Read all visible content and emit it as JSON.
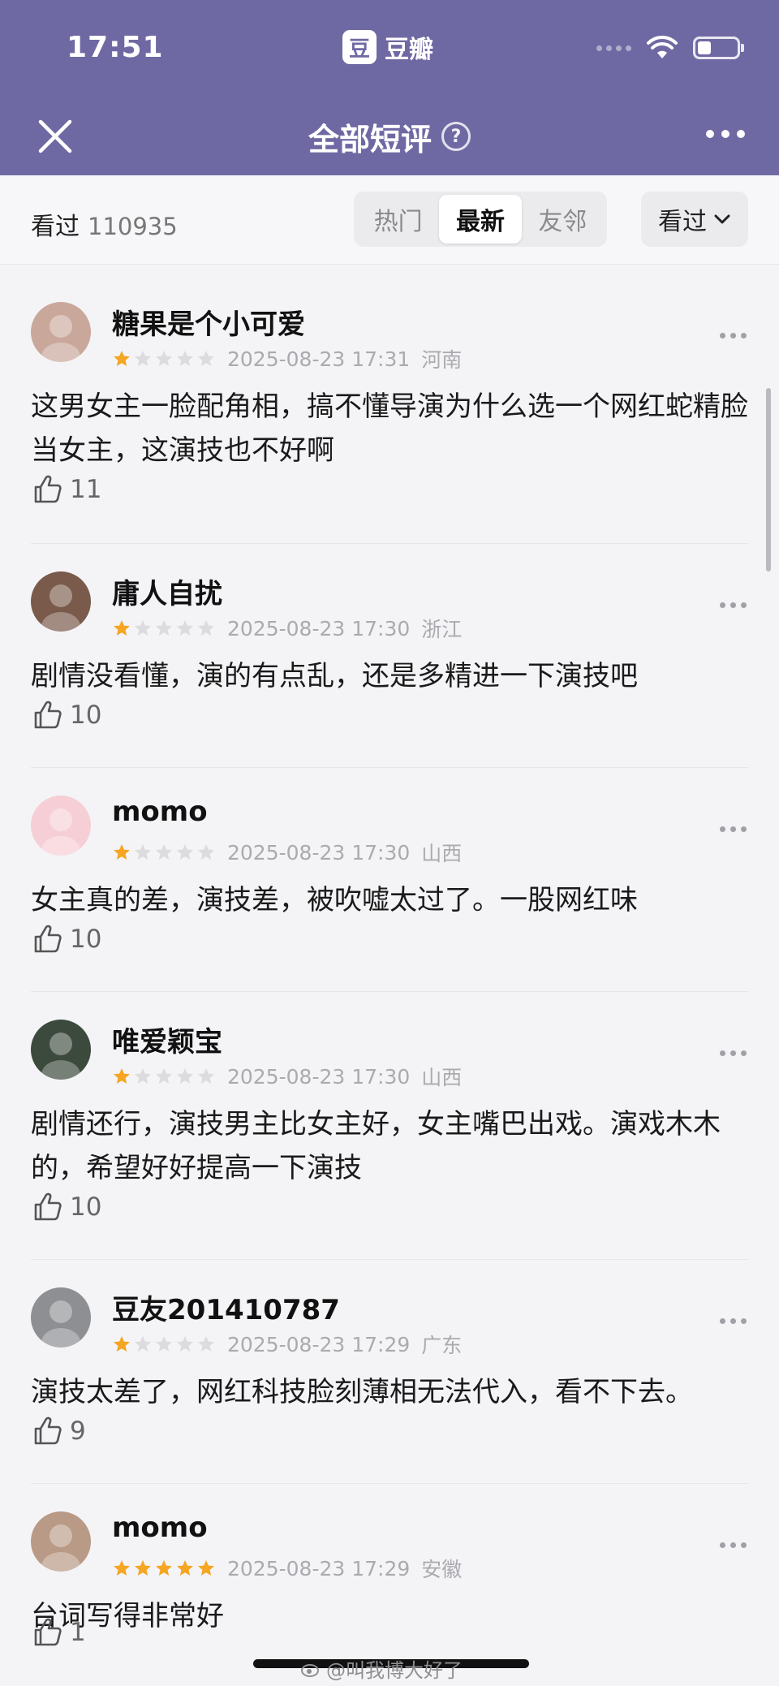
{
  "status_bar": {
    "time": "17:51",
    "app_logo_char": "豆",
    "app_name": "豆瓣",
    "battery_level": 0.35
  },
  "nav": {
    "title": "全部短评",
    "help_symbol": "?"
  },
  "filter": {
    "seen_label": "看过",
    "seen_count": "110935",
    "tabs": [
      {
        "label": "热门",
        "active": false
      },
      {
        "label": "最新",
        "active": true
      },
      {
        "label": "友邻",
        "active": false
      }
    ],
    "dropdown_label": "看过"
  },
  "comments": [
    {
      "user": "糖果是个小可爱",
      "rating": 1,
      "date": "2025-08-23 17:31",
      "location": "河南",
      "content": "这男女主一脸配角相，搞不懂导演为什么选一个网红蛇精脸当女主，这演技也不好啊",
      "likes": "11",
      "avatar_color": "#c9a89b"
    },
    {
      "user": "庸人自扰",
      "rating": 1,
      "date": "2025-08-23 17:30",
      "location": "浙江",
      "content": "剧情没看懂，演的有点乱，还是多精进一下演技吧",
      "likes": "10",
      "avatar_color": "#7a5a4a"
    },
    {
      "user": "momo",
      "rating": 1,
      "date": "2025-08-23 17:30",
      "location": "山西",
      "content": "女主真的差，演技差，被吹嘘太过了。一股网红味",
      "likes": "10",
      "avatar_color": "#f6cfd6"
    },
    {
      "user": "唯爱颖宝",
      "rating": 1,
      "date": "2025-08-23 17:30",
      "location": "山西",
      "content": "剧情还行，演技男主比女主好，女主嘴巴出戏。演戏木木的，希望好好提高一下演技",
      "likes": "10",
      "avatar_color": "#3b4a3c"
    },
    {
      "user": "豆友201410787",
      "rating": 1,
      "date": "2025-08-23 17:29",
      "location": "广东",
      "content": "演技太差了，网红科技脸刻薄相无法代入，看不下去。",
      "likes": "9",
      "avatar_color": "#8d8f93"
    },
    {
      "user": "momo",
      "rating": 5,
      "date": "2025-08-23 17:29",
      "location": "安徽",
      "content": "台词写得非常好",
      "likes": "1",
      "avatar_color": "#b99a86"
    }
  ],
  "watermark": "@叫我博大好了",
  "colors": {
    "header_bg": "#6f69a3",
    "star_on": "#f5a623",
    "star_off": "#dcdcdf"
  }
}
